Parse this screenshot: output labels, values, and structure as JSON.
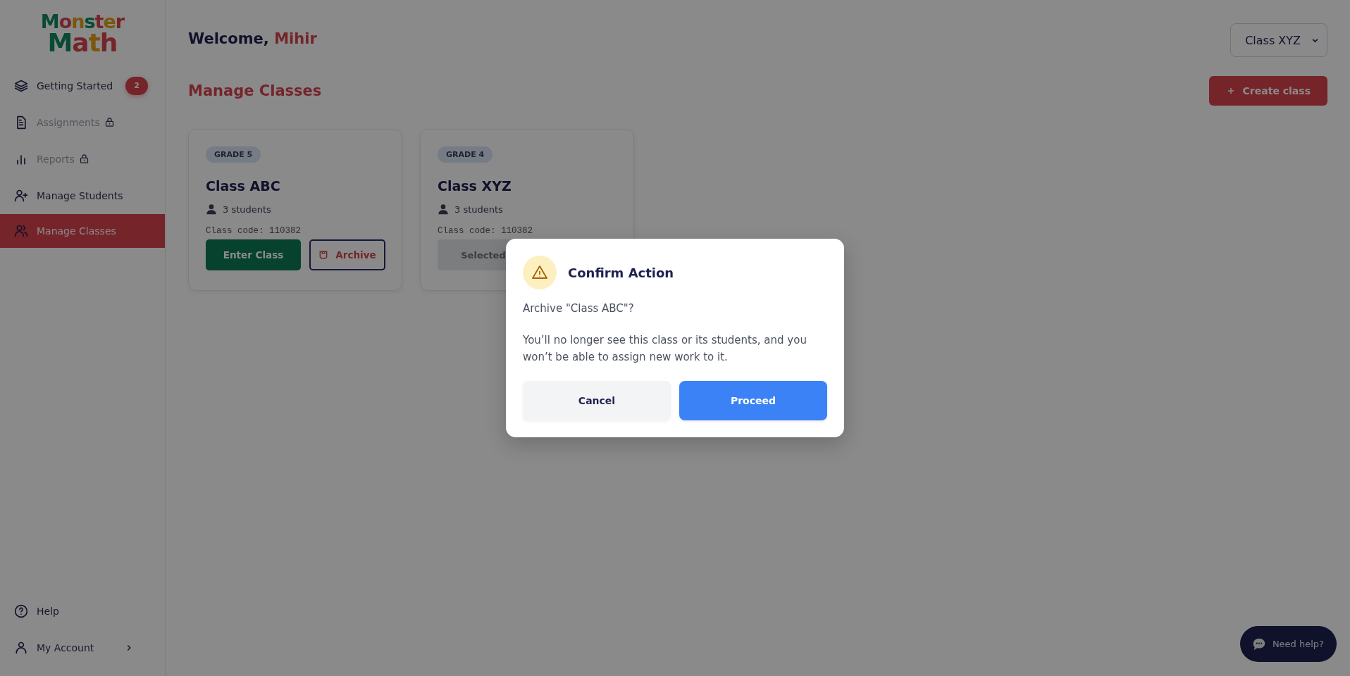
{
  "logo": {
    "line_1": "Monster",
    "line_2": "Math"
  },
  "sidebar": {
    "items": [
      {
        "label": "Getting Started",
        "locked": false,
        "selected": false,
        "badge": "2"
      },
      {
        "label": "Assignments",
        "locked": true,
        "selected": false
      },
      {
        "label": "Reports",
        "locked": true,
        "selected": false
      },
      {
        "label": "Manage Students",
        "locked": false,
        "selected": false
      },
      {
        "label": "Manage Classes",
        "locked": false,
        "selected": true
      }
    ],
    "footer_items": [
      {
        "label": "Help",
        "has_submenu": false
      },
      {
        "label": "My Account",
        "has_submenu": true
      }
    ]
  },
  "header": {
    "greeting": "Welcome,",
    "user_name": "Mihir",
    "class_select": {
      "value": "Class XYZ"
    }
  },
  "section": {
    "title": "Manage Classes",
    "create_button": "Create class"
  },
  "classes": [
    {
      "grade": "GRADE 5",
      "name": "Class ABC",
      "students": "3 students",
      "code": "Class code: 110382",
      "actions": [
        {
          "kind": "enter",
          "label": "Enter Class"
        },
        {
          "kind": "archive",
          "label": "Archive"
        }
      ]
    },
    {
      "grade": "GRADE 4",
      "name": "Class XYZ",
      "students": "3 students",
      "code": "Class code: 110382",
      "actions": [
        {
          "kind": "selected",
          "label": "Selected"
        }
      ]
    }
  ],
  "dialog": {
    "title": "Confirm Action",
    "question": "Archive \"Class ABC\"?",
    "message": "You’ll no longer see this class or its students, and you won’t be able to assign new work to it.",
    "cancel": "Cancel",
    "confirm": "Proceed"
  },
  "help_button": {
    "label": "Need help?"
  }
}
